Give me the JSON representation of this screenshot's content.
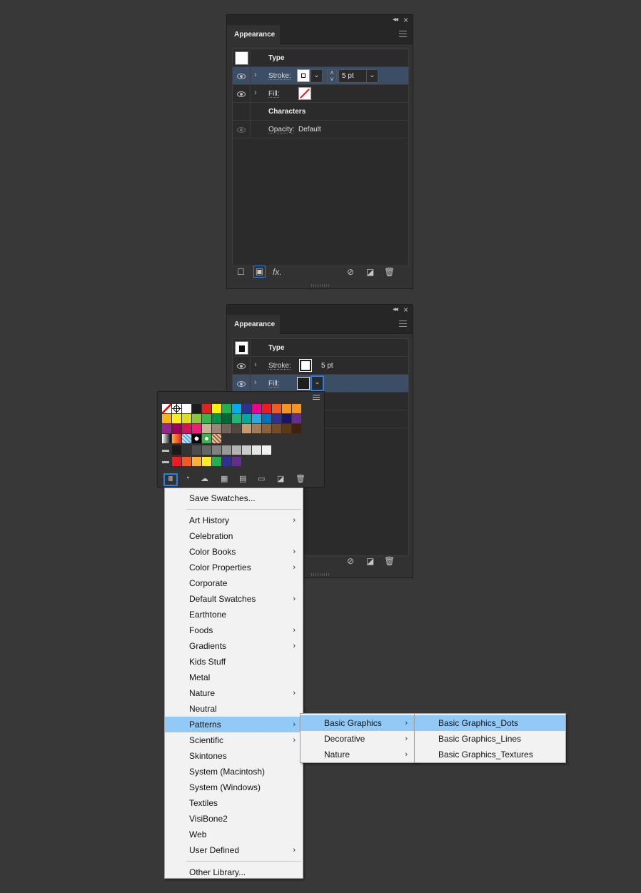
{
  "panel_top": {
    "tab": "Appearance",
    "rows": {
      "type_label": "Type",
      "stroke_label": "Stroke:",
      "stroke_weight": "5 pt",
      "fill_label": "Fill:",
      "characters_label": "Characters",
      "opacity_label": "Opacity:",
      "opacity_value": "Default"
    },
    "footer_fx": "fx."
  },
  "panel_bottom": {
    "tab": "Appearance",
    "rows": {
      "type_label": "Type",
      "stroke_label": "Stroke:",
      "stroke_weight": "5 pt",
      "fill_label": "Fill:"
    }
  },
  "library_menu": {
    "items": [
      {
        "label": "Save Swatches...",
        "submenu": false
      },
      {
        "label": "Art History",
        "submenu": true
      },
      {
        "label": "Celebration",
        "submenu": false
      },
      {
        "label": "Color Books",
        "submenu": true
      },
      {
        "label": "Color Properties",
        "submenu": true
      },
      {
        "label": "Corporate",
        "submenu": false
      },
      {
        "label": "Default Swatches",
        "submenu": true
      },
      {
        "label": "Earthtone",
        "submenu": false
      },
      {
        "label": "Foods",
        "submenu": true
      },
      {
        "label": "Gradients",
        "submenu": true
      },
      {
        "label": "Kids Stuff",
        "submenu": false
      },
      {
        "label": "Metal",
        "submenu": false
      },
      {
        "label": "Nature",
        "submenu": true
      },
      {
        "label": "Neutral",
        "submenu": false
      },
      {
        "label": "Patterns",
        "submenu": true
      },
      {
        "label": "Scientific",
        "submenu": true
      },
      {
        "label": "Skintones",
        "submenu": false
      },
      {
        "label": "System (Macintosh)",
        "submenu": false
      },
      {
        "label": "System (Windows)",
        "submenu": false
      },
      {
        "label": "Textiles",
        "submenu": false
      },
      {
        "label": "VisiBone2",
        "submenu": false
      },
      {
        "label": "Web",
        "submenu": false
      },
      {
        "label": "User Defined",
        "submenu": true
      },
      {
        "label": "Other Library...",
        "submenu": false
      }
    ]
  },
  "patterns_menu": {
    "items": [
      {
        "label": "Basic Graphics",
        "submenu": true
      },
      {
        "label": "Decorative",
        "submenu": true
      },
      {
        "label": "Nature",
        "submenu": true
      }
    ]
  },
  "basic_graphics_menu": {
    "items": [
      {
        "label": "Basic Graphics_Dots"
      },
      {
        "label": "Basic Graphics_Lines"
      },
      {
        "label": "Basic Graphics_Textures"
      }
    ]
  },
  "swatch_colors": {
    "row1": [
      "#ffffff",
      "#ffffff",
      "#ffffff",
      "#1c1c1c",
      "#e22121",
      "#fff200",
      "#22b14c",
      "#00aeef",
      "#2e3192",
      "#ec008c",
      "#ed1c24",
      "#f15a24",
      "#f7941d",
      "#f7941d"
    ],
    "row2": [
      "#f7b51b",
      "#fcee21",
      "#d9e021",
      "#8cc63f",
      "#39b54a",
      "#009245",
      "#006837",
      "#22b573",
      "#00a99d",
      "#29abe2",
      "#0071bc",
      "#2e3192",
      "#1b1464",
      "#662d91"
    ],
    "row3": [
      "#93278f",
      "#9e005d",
      "#d4145a",
      "#ed1e79",
      "#c7b299",
      "#998675",
      "#736357",
      "#534741",
      "#c69c6d",
      "#a67c52",
      "#8c6239",
      "#754c24",
      "#603813",
      "#42210b"
    ],
    "gray_row": [
      "#1a1a1a",
      "#333333",
      "#4d4d4d",
      "#666666",
      "#808080",
      "#999999",
      "#b3b3b3",
      "#cccccc",
      "#e6e6e6",
      "#f2f2f2"
    ],
    "bright_row": [
      "#ed1c24",
      "#f15a24",
      "#fbb03b",
      "#fcee21",
      "#22b14c",
      "#2e3192",
      "#662d91"
    ]
  }
}
